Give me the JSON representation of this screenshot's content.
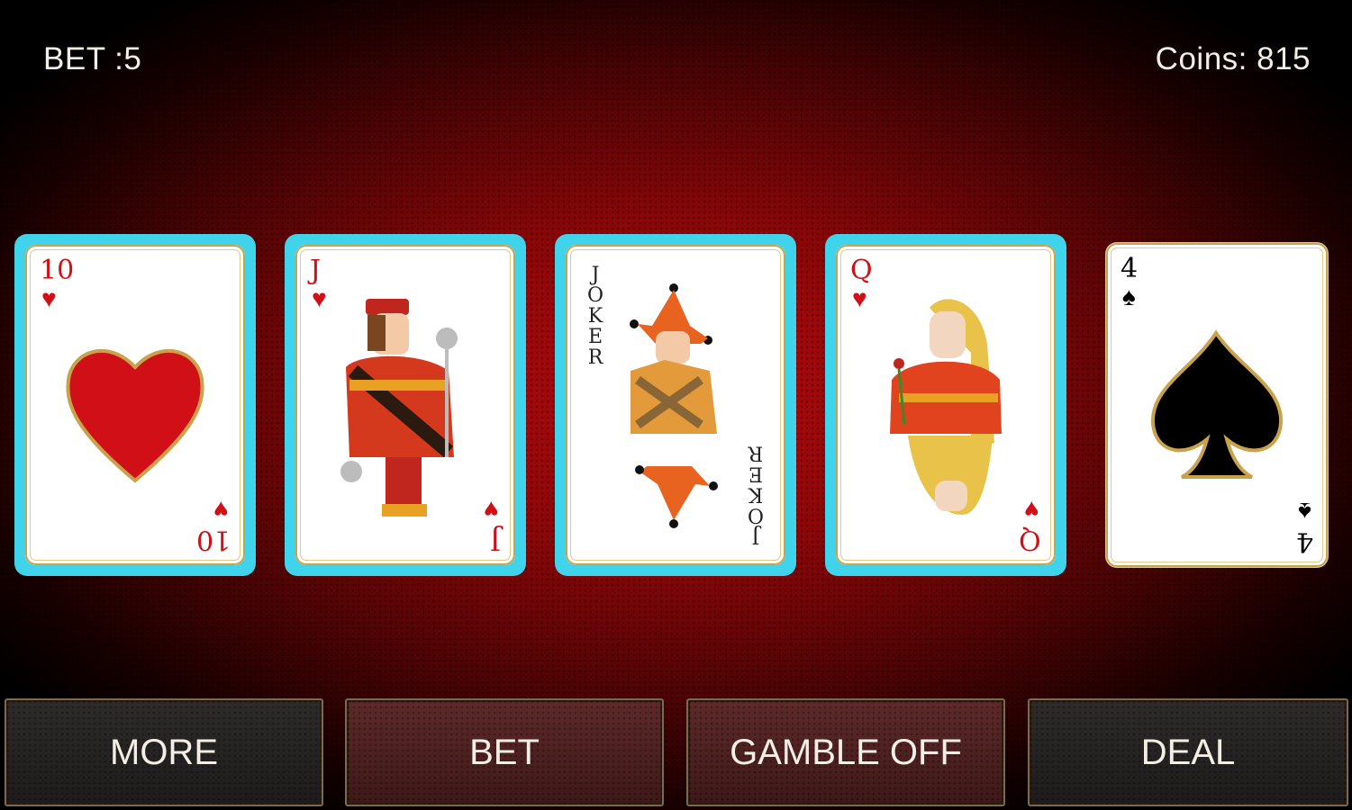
{
  "hud": {
    "bet": "BET :5",
    "coins": "Coins: 815"
  },
  "cards": [
    {
      "rank": "10",
      "suit": "hearts",
      "suit_glyph": "♥",
      "held": true
    },
    {
      "rank": "J",
      "suit": "hearts",
      "suit_glyph": "♥",
      "held": true
    },
    {
      "rank": "JOKER",
      "suit": "joker",
      "held": true
    },
    {
      "rank": "Q",
      "suit": "hearts",
      "suit_glyph": "♥",
      "held": true
    },
    {
      "rank": "4",
      "suit": "spades",
      "suit_glyph": "♠",
      "held": false
    }
  ],
  "joker_letters": [
    "J",
    "O",
    "K",
    "E",
    "R"
  ],
  "buttons": {
    "more": "MORE",
    "bet": "BET",
    "gamble": "GAMBLE OFF",
    "deal": "DEAL"
  },
  "colors": {
    "hold_highlight": "#3fd4ec",
    "heart_red": "#d10f16",
    "table_red": "#b50a0d"
  }
}
